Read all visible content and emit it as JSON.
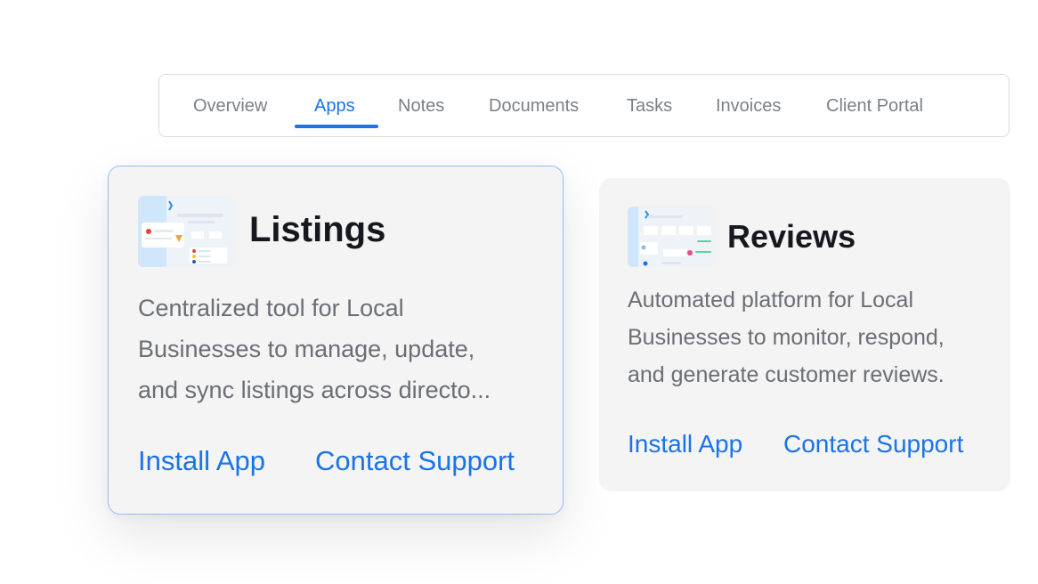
{
  "tabs": [
    {
      "label": "Overview",
      "active": false
    },
    {
      "label": "Apps",
      "active": true
    },
    {
      "label": "Notes",
      "active": false
    },
    {
      "label": "Documents",
      "active": false
    },
    {
      "label": "Tasks",
      "active": false
    },
    {
      "label": "Invoices",
      "active": false
    },
    {
      "label": "Client Portal",
      "active": false
    }
  ],
  "colors": {
    "accent": "#1a73e8",
    "tab_inactive": "#7b8088",
    "card_bg": "#f4f4f5",
    "card_selected_border": "#8ec0f4",
    "title": "#16181d",
    "description": "#6b6e74"
  },
  "apps": [
    {
      "title": "Listings",
      "thumbnail_icon": "listings-preview-thumbnail",
      "description_lines": [
        "Centralized tool for Local",
        "Businesses to manage, update,",
        "and sync listings across directo..."
      ],
      "install_label": "Install App",
      "support_label": "Contact Support",
      "selected": true
    },
    {
      "title": "Reviews",
      "thumbnail_icon": "reviews-preview-thumbnail",
      "description_lines": [
        "Automated platform for Local",
        "Businesses to monitor, respond,",
        "and generate customer reviews."
      ],
      "install_label": "Install App",
      "support_label": "Contact Support",
      "selected": false
    }
  ]
}
